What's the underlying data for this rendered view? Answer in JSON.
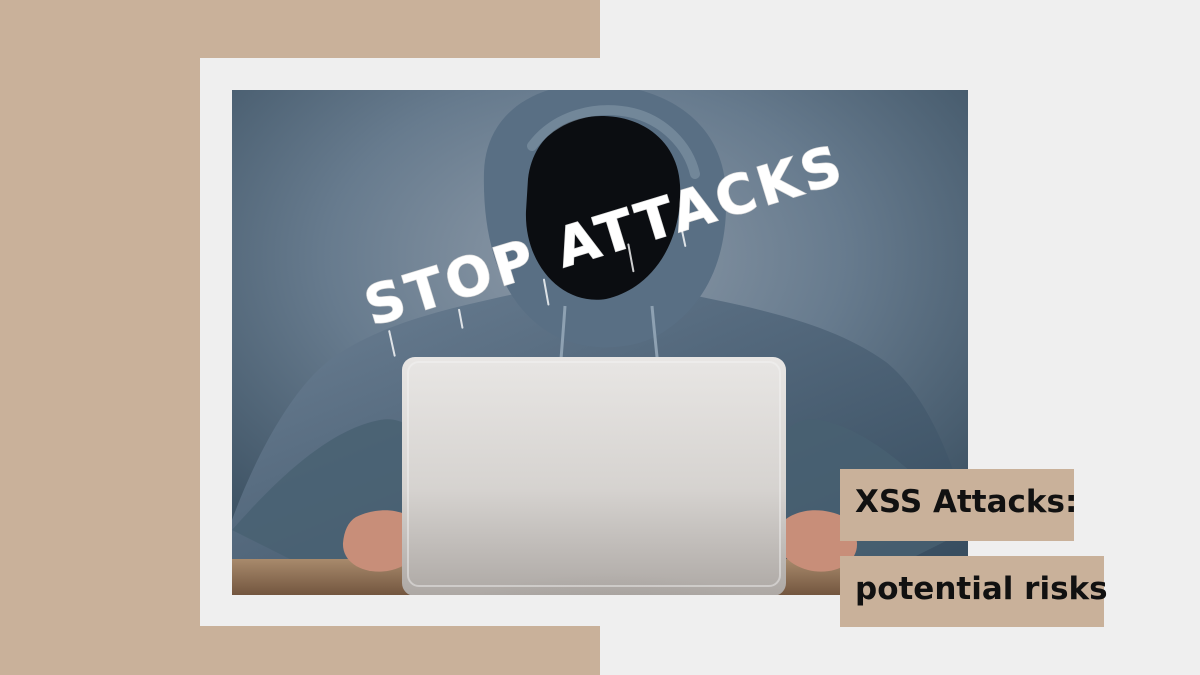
{
  "hero": {
    "graffiti_text": "STOP ATTACKS"
  },
  "caption": {
    "line_1": "XSS Attacks:",
    "line_2": "potential risks"
  },
  "colors": {
    "beige": "#c9b19a",
    "background": "#efefef",
    "caption_text": "#111111"
  }
}
